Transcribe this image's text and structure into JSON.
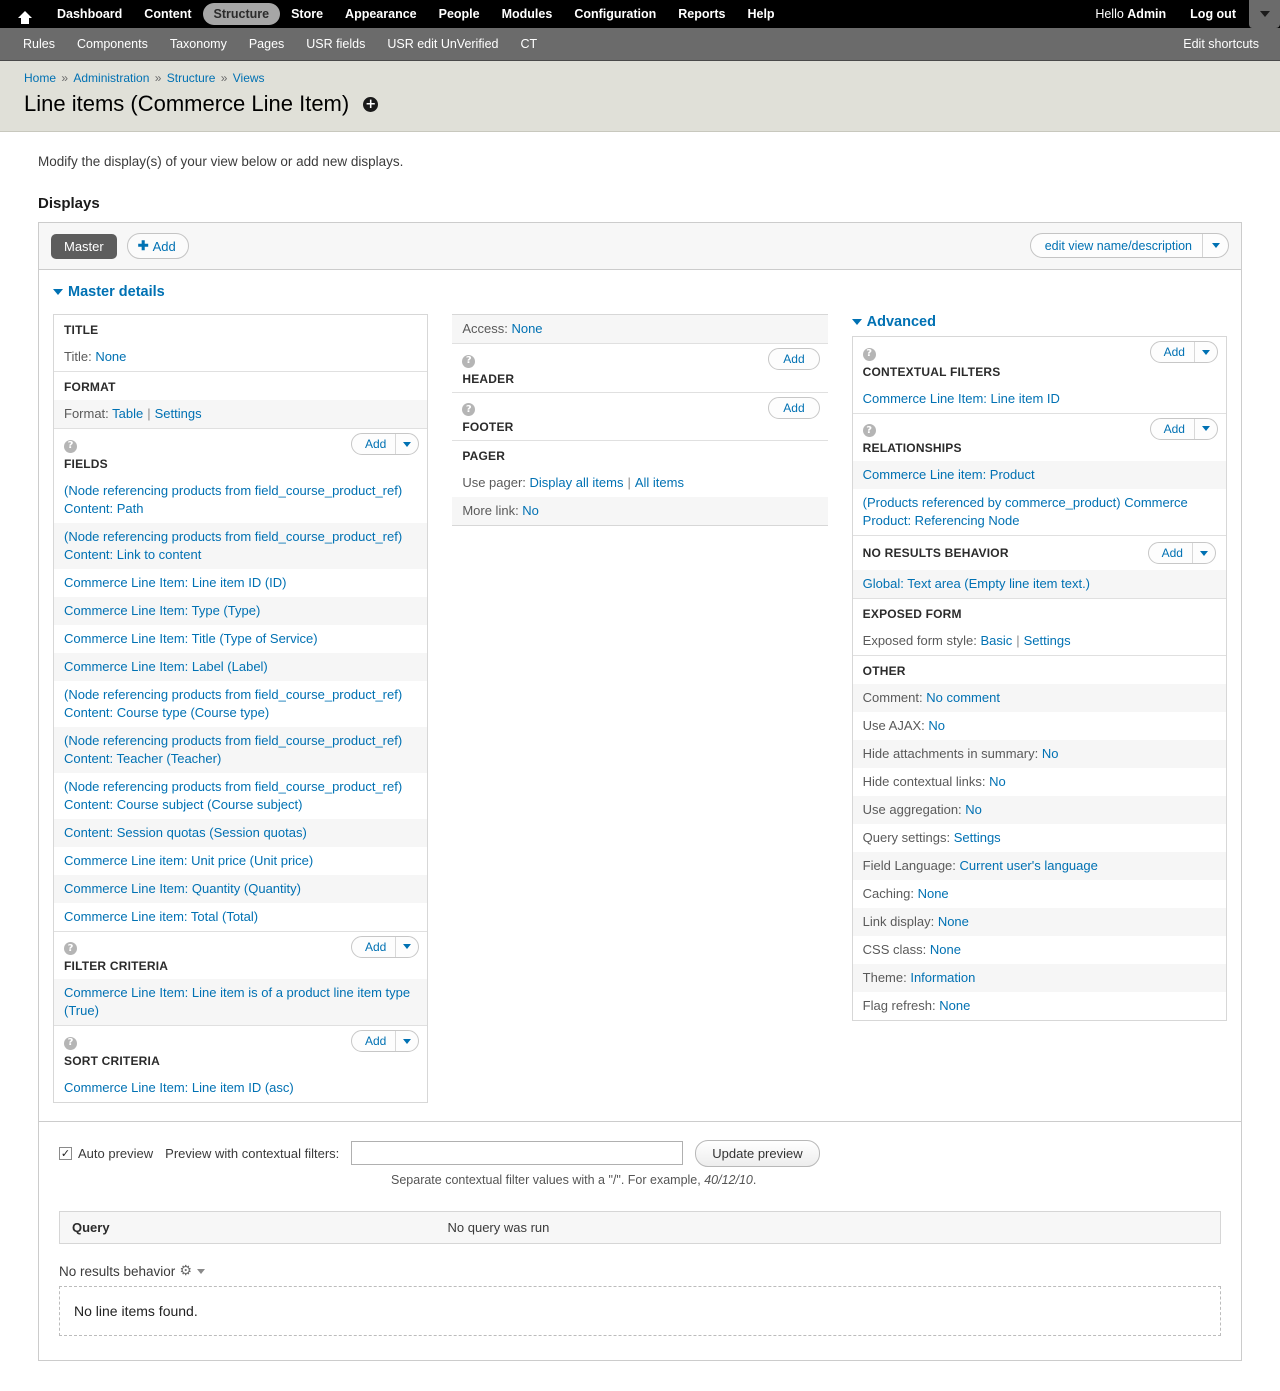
{
  "toolbar": {
    "home_icon": "home-icon",
    "menu": [
      {
        "label": "Dashboard",
        "active": false
      },
      {
        "label": "Content",
        "active": false
      },
      {
        "label": "Structure",
        "active": true
      },
      {
        "label": "Store",
        "active": false
      },
      {
        "label": "Appearance",
        "active": false
      },
      {
        "label": "People",
        "active": false
      },
      {
        "label": "Modules",
        "active": false
      },
      {
        "label": "Configuration",
        "active": false
      },
      {
        "label": "Reports",
        "active": false
      },
      {
        "label": "Help",
        "active": false
      }
    ],
    "greeting_prefix": "Hello ",
    "greeting_user": "Admin",
    "logout_label": "Log out",
    "toggle_icon": "chevron-down-icon"
  },
  "shortcuts": {
    "items": [
      "Rules",
      "Components",
      "Taxonomy",
      "Pages",
      "USR fields",
      "USR edit UnVerified",
      "CT"
    ],
    "edit_label": "Edit shortcuts"
  },
  "breadcrumb": {
    "items": [
      "Home",
      "Administration",
      "Structure",
      "Views"
    ],
    "separator": "»"
  },
  "page": {
    "title": "Line items (Commerce Line Item)",
    "ctx_badge": "✛",
    "intro": "Modify the display(s) of your view below or add new displays.",
    "displays_heading": "Displays"
  },
  "displays": {
    "master_tab": "Master",
    "add_label": "Add",
    "add_plus": "✚",
    "edit_view_label": "edit view name/description",
    "details_toggle": "Master details"
  },
  "left_column": [
    {
      "title": "TITLE",
      "help": false,
      "add": null,
      "rows": [
        {
          "type": "kv",
          "label": "Title:",
          "value": "None"
        }
      ]
    },
    {
      "title": "FORMAT",
      "help": false,
      "add": null,
      "rows": [
        {
          "type": "kv2",
          "label": "Format:",
          "value": "Table",
          "value2": "Settings"
        }
      ]
    },
    {
      "title": "FIELDS",
      "help": true,
      "add": {
        "label": "Add",
        "arrow": true
      },
      "rows": [
        {
          "type": "link",
          "text": "(Node referencing products from field_course_product_ref) Content: Path"
        },
        {
          "type": "link",
          "text": "(Node referencing products from field_course_product_ref) Content: Link to content"
        },
        {
          "type": "link",
          "text": "Commerce Line Item: Line item ID (ID)"
        },
        {
          "type": "link",
          "text": "Commerce Line Item: Type (Type)"
        },
        {
          "type": "link",
          "text": "Commerce Line Item: Title (Type of Service)"
        },
        {
          "type": "link",
          "text": "Commerce Line Item: Label (Label)"
        },
        {
          "type": "link",
          "text": "(Node referencing products from field_course_product_ref) Content: Course type (Course type)"
        },
        {
          "type": "link",
          "text": "(Node referencing products from field_course_product_ref) Content: Teacher (Teacher)"
        },
        {
          "type": "link",
          "text": "(Node referencing products from field_course_product_ref) Content: Course subject (Course subject)"
        },
        {
          "type": "link",
          "text": "Content: Session quotas (Session quotas)"
        },
        {
          "type": "link",
          "text": "Commerce Line item: Unit price (Unit price)"
        },
        {
          "type": "link",
          "text": "Commerce Line Item: Quantity (Quantity)"
        },
        {
          "type": "link",
          "text": "Commerce Line item: Total (Total)"
        }
      ]
    },
    {
      "title": "FILTER CRITERIA",
      "help": true,
      "add": {
        "label": "Add",
        "arrow": true
      },
      "rows": [
        {
          "type": "link",
          "text": "Commerce Line Item: Line item is of a product line item type (True)"
        }
      ]
    },
    {
      "title": "SORT CRITERIA",
      "help": true,
      "add": {
        "label": "Add",
        "arrow": true
      },
      "rows": [
        {
          "type": "link",
          "text": "Commerce Line Item: Line item ID (asc)"
        }
      ]
    }
  ],
  "mid_column": {
    "access": {
      "label": "Access:",
      "value": "None"
    },
    "buckets": [
      {
        "title": "HEADER",
        "help": true,
        "add": {
          "label": "Add",
          "arrow": false
        },
        "rows": []
      },
      {
        "title": "FOOTER",
        "help": true,
        "add": {
          "label": "Add",
          "arrow": false
        },
        "rows": []
      },
      {
        "title": "PAGER",
        "help": false,
        "add": null,
        "rows": [
          {
            "type": "kv2",
            "label": "Use pager:",
            "value": "Display all items",
            "value2": "All items"
          },
          {
            "type": "kv",
            "label": "More link:",
            "value": "No"
          }
        ]
      }
    ]
  },
  "right_column": {
    "advanced_toggle": "Advanced",
    "buckets": [
      {
        "title": "CONTEXTUAL FILTERS",
        "help": true,
        "add": {
          "label": "Add",
          "arrow": true
        },
        "rows": [
          {
            "type": "link",
            "text": "Commerce Line Item: Line item ID"
          }
        ]
      },
      {
        "title": "RELATIONSHIPS",
        "help": true,
        "add": {
          "label": "Add",
          "arrow": true
        },
        "rows": [
          {
            "type": "link",
            "text": "Commerce Line item: Product"
          },
          {
            "type": "link",
            "text": "(Products referenced by commerce_product) Commerce Product: Referencing Node"
          }
        ]
      },
      {
        "title": "NO RESULTS BEHAVIOR",
        "help": false,
        "inline_add": true,
        "add": {
          "label": "Add",
          "arrow": true
        },
        "rows": [
          {
            "type": "link",
            "text": "Global: Text area (Empty line item text.)"
          }
        ]
      },
      {
        "title": "EXPOSED FORM",
        "help": false,
        "add": null,
        "rows": [
          {
            "type": "kv2",
            "label": "Exposed form style:",
            "value": "Basic",
            "value2": "Settings"
          }
        ]
      },
      {
        "title": "OTHER",
        "help": false,
        "add": null,
        "rows": [
          {
            "type": "kv",
            "label": "Comment:",
            "value": "No comment"
          },
          {
            "type": "kv",
            "label": "Use AJAX:",
            "value": "No"
          },
          {
            "type": "kv",
            "label": "Hide attachments in summary:",
            "value": "No"
          },
          {
            "type": "kv",
            "label": "Hide contextual links:",
            "value": "No"
          },
          {
            "type": "kv",
            "label": "Use aggregation:",
            "value": "No"
          },
          {
            "type": "kv",
            "label": "Query settings:",
            "value": "Settings"
          },
          {
            "type": "kv",
            "label": "Field Language:",
            "value": "Current user's language"
          },
          {
            "type": "kv",
            "label": "Caching:",
            "value": "None"
          },
          {
            "type": "kv",
            "label": "Link display:",
            "value": "None"
          },
          {
            "type": "kv",
            "label": "CSS class:",
            "value": "None"
          },
          {
            "type": "kv",
            "label": "Theme:",
            "value": "Information"
          },
          {
            "type": "kv",
            "label": "Flag refresh:",
            "value": "None"
          }
        ]
      }
    ]
  },
  "preview": {
    "auto_preview_label": "Auto preview",
    "auto_preview_checked": true,
    "checkbox_glyph": "✓",
    "contextual_label": "Preview with contextual filters:",
    "contextual_value": "",
    "contextual_placeholder": "",
    "update_button": "Update preview",
    "hint_before": "Separate contextual filter values with a \"/\". For example, ",
    "hint_example": "40/12/10",
    "hint_after": ".",
    "query_header": "Query",
    "query_value": "No query was run",
    "no_results_label": "No results behavior",
    "gear_icon": "gear-icon",
    "no_results_text": "No line items found."
  },
  "colors": {
    "link": "#0071b3",
    "toolbar_bg": "#000000",
    "shortcut_bg": "#6b6b6b",
    "page_head_bg": "#e0e0d8",
    "row_alt": "#f6f6f6"
  }
}
